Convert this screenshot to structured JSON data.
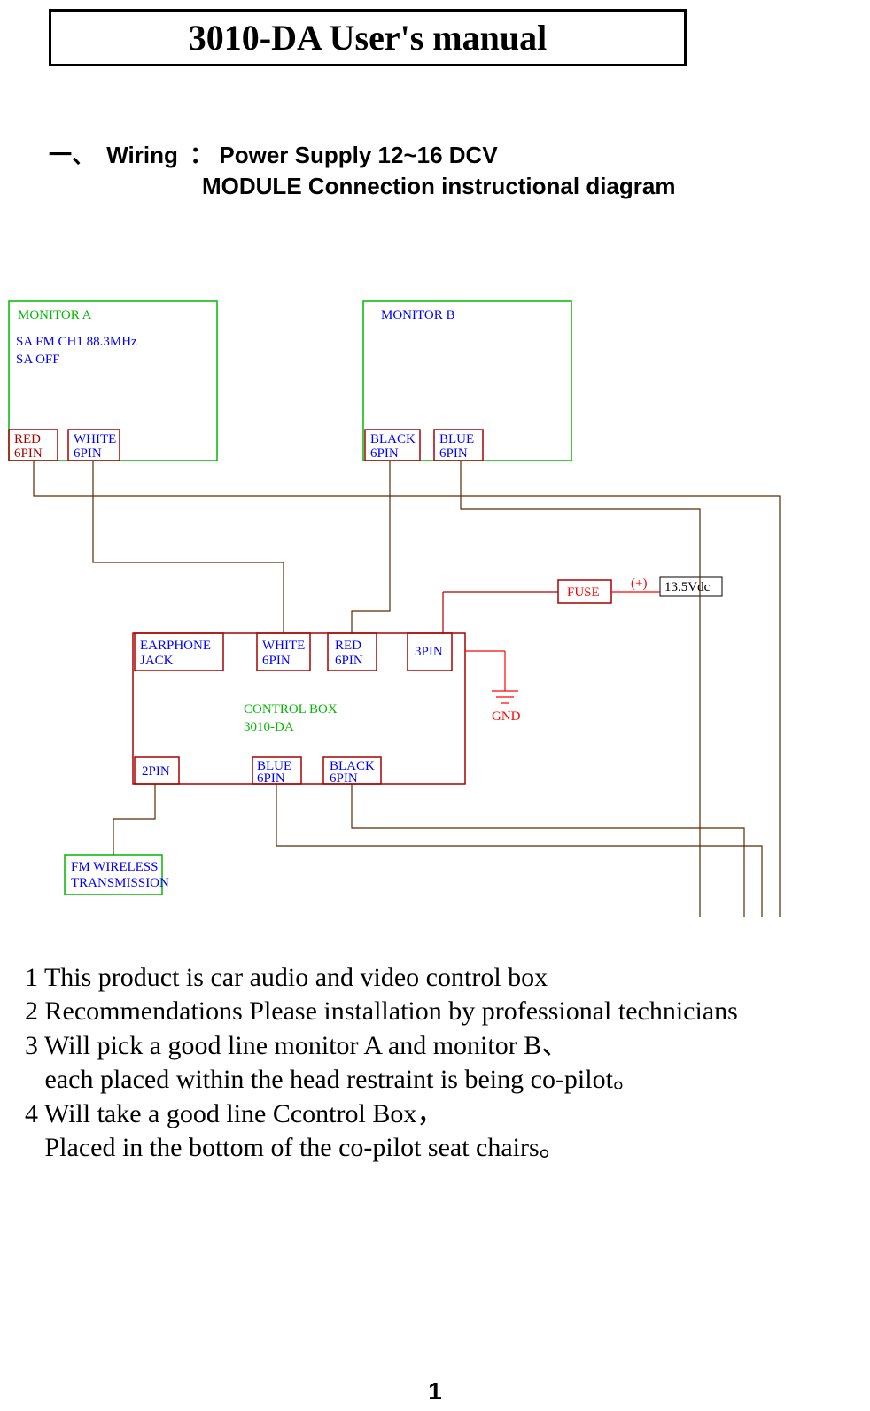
{
  "title": "3010-DA User's  manual",
  "section_prefix": "一、",
  "section_wiring": "Wiring",
  "section_colon": "：",
  "section_power": "Power Supply  12~16 DCV",
  "section_module": "MODULE Connection instructional diagram",
  "diagram": {
    "monitor_a": "MONITOR A",
    "sa_fm": "SA FM CH1 88.3MHz",
    "sa_off": "SA OFF",
    "monitor_b": "MONITOR B",
    "red_6pin": "RED",
    "red_6pin2": "6PIN",
    "white_6pin": "WHITE",
    "white_6pin2": "6PIN",
    "black_6pin": "BLACK",
    "black_6pin2": "6PIN",
    "blue_6pin": "BLUE",
    "blue_6pin2": "6PIN",
    "fuse": "FUSE",
    "plus": "(+)",
    "vdc": "13.5Vdc",
    "earphone1": "EARPHONE",
    "earphone2": "JACK",
    "ctrl_white1": "WHITE",
    "ctrl_white2": "6PIN",
    "ctrl_red1": "RED",
    "ctrl_red2": "6PIN",
    "3pin": "3PIN",
    "control1": "CONTROL BOX",
    "control2": "3010-DA",
    "2pin": "2PIN",
    "ctrl_blue1": "BLUE",
    "ctrl_blue2": "6PIN",
    "ctrl_black1": "BLACK",
    "ctrl_black2": "6PIN",
    "gnd": "GND",
    "fm1": "FM WIRELESS",
    "fm2": "TRANSMISSION"
  },
  "notes": {
    "n1": "1 This product is car audio and video control box",
    "n2": "2 Recommendations Please installation by professional technicians",
    "n3": "3 Will pick a good line monitor A and monitor B、",
    "n3b": "   each placed within the head restraint is being co-pilot。",
    "n4": "4 Will take a good line Ccontrol Box，",
    "n4b": "   Placed in the bottom of the co-pilot seat chairs。"
  },
  "page_number": "1"
}
